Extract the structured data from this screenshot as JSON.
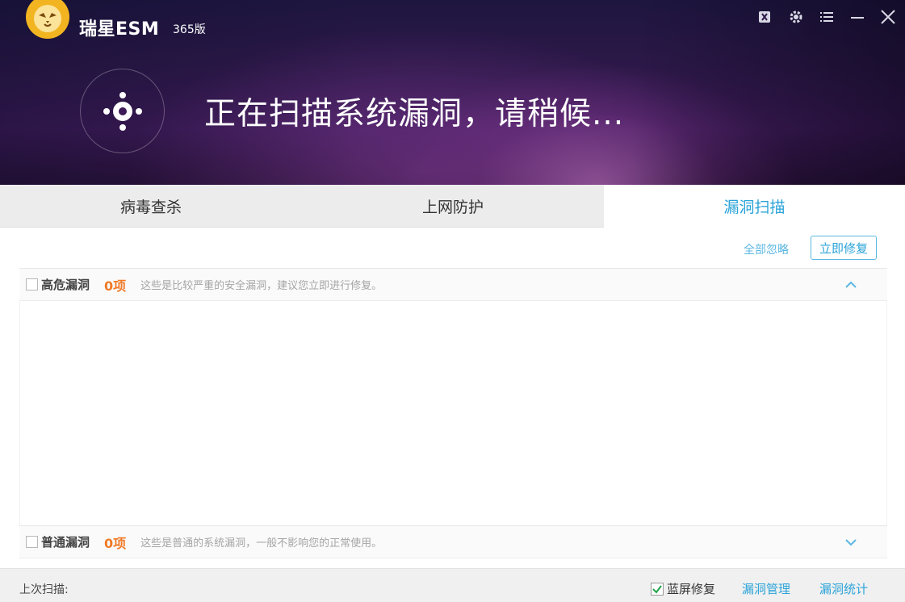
{
  "window": {
    "brand": "瑞星ESM",
    "edition": "365版",
    "controls": [
      "shield-off-icon",
      "gear-icon",
      "menu-icon",
      "minimize-icon",
      "close-icon"
    ]
  },
  "banner": {
    "status_title": "正在扫描系统漏洞，请稍候..."
  },
  "tabs": [
    {
      "label": "病毒查杀",
      "active": false
    },
    {
      "label": "上网防护",
      "active": false
    },
    {
      "label": "漏洞扫描",
      "active": true
    }
  ],
  "actions": {
    "ignore_all": "全部忽略",
    "fix_now": "立即修复"
  },
  "groups": [
    {
      "name": "高危漏洞",
      "count": "0项",
      "description": "这些是比较严重的安全漏洞，建议您立即进行修复。",
      "checked": false,
      "expanded": true
    },
    {
      "name": "普通漏洞",
      "count": "0项",
      "description": "这些是普通的系统漏洞，一般不影响您的正常使用。",
      "checked": false,
      "expanded": false
    }
  ],
  "footer": {
    "last_scan": "上次扫描:",
    "bsod_fix": "蓝屏修复",
    "bsod_checked": true,
    "vuln_manage": "漏洞管理",
    "vuln_stats": "漏洞统计"
  },
  "colors": {
    "accent": "#2aa3d8",
    "count": "#f07a28",
    "header_dark": "#2c1848"
  }
}
